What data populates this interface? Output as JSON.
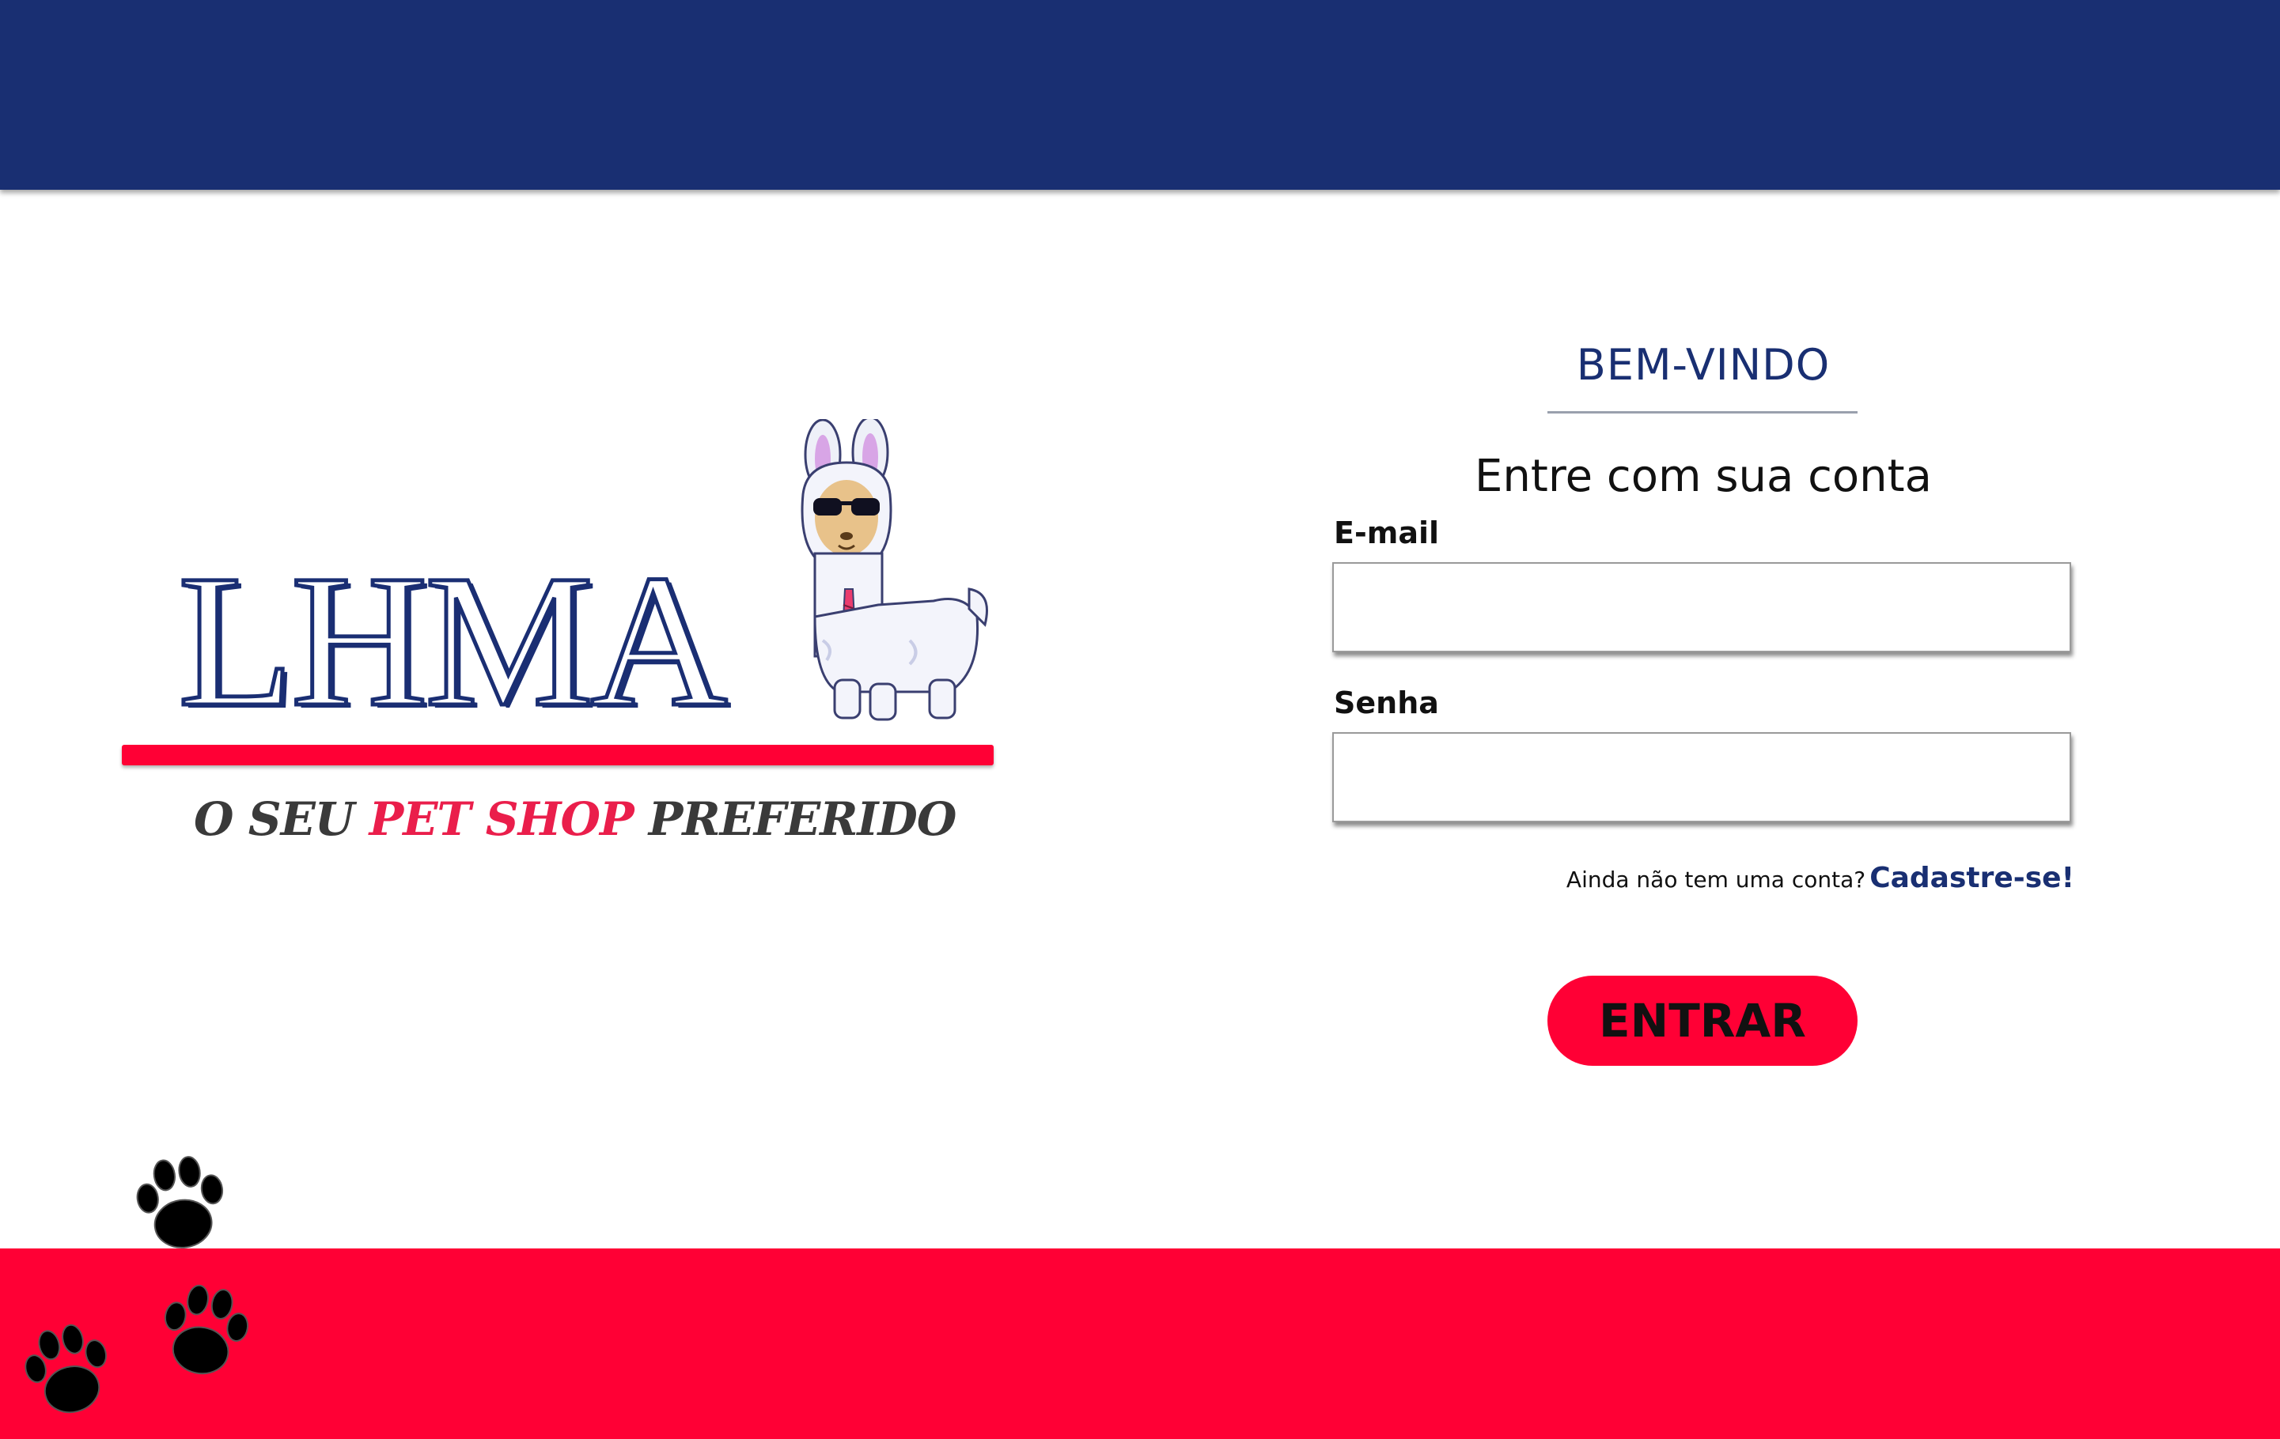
{
  "colors": {
    "navy": "#192f72",
    "red": "#ff0035",
    "pink": "#ea1e4b",
    "dark_gray": "#3a3a3a",
    "black": "#000000"
  },
  "brand": {
    "logo_text": "LHMA",
    "tagline_part1": "O SEU ",
    "tagline_highlight": "PET SHOP",
    "tagline_part2": " PREFERIDO",
    "mascot_icon": "llama-sunglasses-icon"
  },
  "login": {
    "welcome": "BEM-VINDO",
    "subtitle": "Entre com sua conta",
    "email_label": "E-mail",
    "email_value": "",
    "password_label": "Senha",
    "password_value": "",
    "signup_prompt": "Ainda não tem uma conta?",
    "signup_link": "Cadastre-se!",
    "submit_label": "ENTRAR"
  },
  "decor": {
    "paw_icon": "paw-print-icon"
  }
}
